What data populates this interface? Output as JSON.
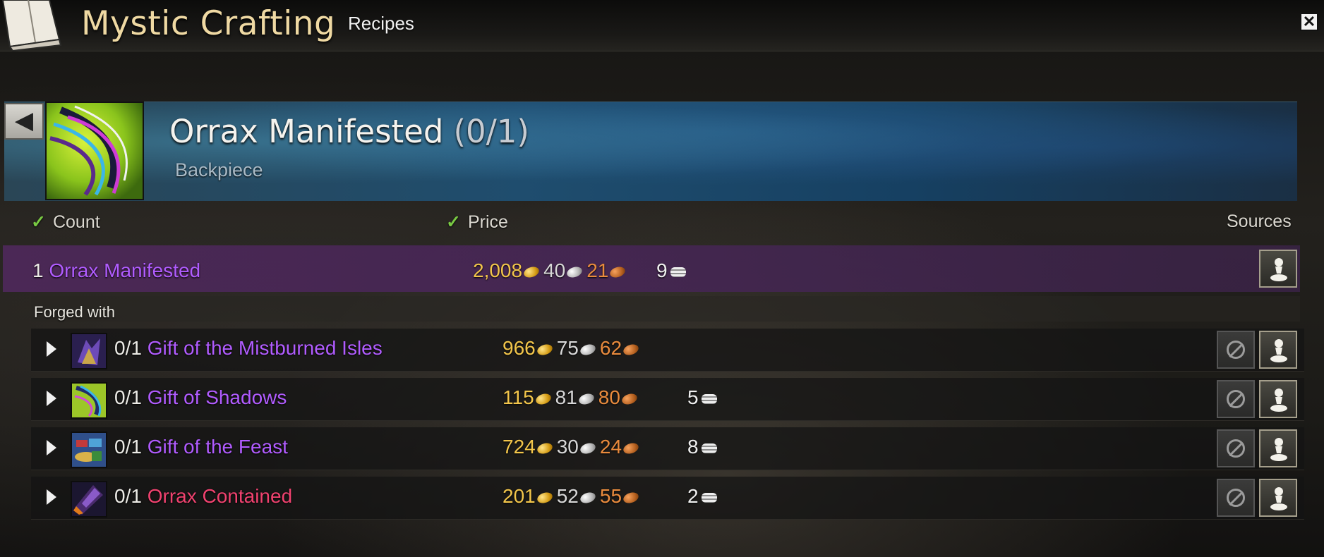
{
  "window": {
    "title": "Mystic Crafting",
    "tab": "Recipes",
    "close_label": "✕"
  },
  "item": {
    "name": "Orrax Manifested",
    "progress": "(0/1)",
    "type": "Backpiece",
    "back_label": "◀"
  },
  "columns": {
    "count": "Count",
    "price": "Price",
    "sources": "Sources"
  },
  "main": {
    "qty": "1",
    "name": "Orrax Manifested",
    "gold": "2,008",
    "silver": "40",
    "copper": "21",
    "karma": "9"
  },
  "forged_with_label": "Forged with",
  "ingredients": [
    {
      "progress": "0/1",
      "name": "Gift of the Mistburned Isles",
      "rarity": "exotic",
      "gold": "966",
      "silver": "75",
      "copper": "62",
      "karma": ""
    },
    {
      "progress": "0/1",
      "name": "Gift of Shadows",
      "rarity": "exotic",
      "gold": "115",
      "silver": "81",
      "copper": "80",
      "karma": "5"
    },
    {
      "progress": "0/1",
      "name": "Gift of the Feast",
      "rarity": "exotic",
      "gold": "724",
      "silver": "30",
      "copper": "24",
      "karma": "8"
    },
    {
      "progress": "0/1",
      "name": "Orrax Contained",
      "rarity": "ascended",
      "gold": "201",
      "silver": "52",
      "copper": "55",
      "karma": "2"
    }
  ],
  "icons": {
    "check": "checkmark-icon",
    "coin_gold": "gold-coin-icon",
    "coin_silver": "silver-coin-icon",
    "coin_copper": "copper-coin-icon",
    "karma": "karma-coin-stack-icon",
    "source": "pawn-source-icon",
    "disabled": "no-symbol-icon"
  },
  "colors": {
    "exotic": "#b15cff",
    "ascended": "#f0426f",
    "gold": "#f3c64b",
    "silver": "#d8d8d8",
    "copper": "#e98b3d",
    "title": "#efd9a3",
    "check": "#79c943"
  }
}
